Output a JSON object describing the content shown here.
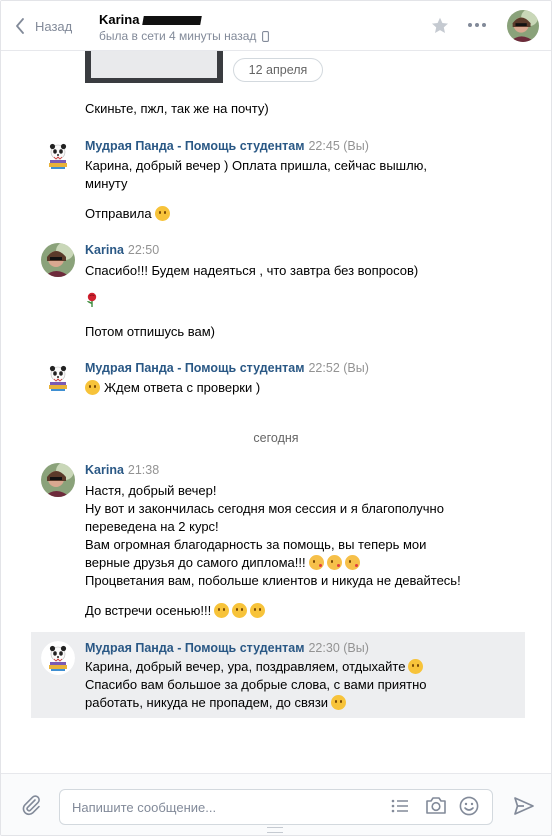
{
  "header": {
    "back_label": "Назад",
    "chat_name": "Karina",
    "status": "была в сети 4 минуты назад"
  },
  "dates": {
    "pill": "12 апреля",
    "separator": "сегодня"
  },
  "compose": {
    "placeholder": "Напишите сообщение..."
  },
  "colors": {
    "author": "#2a5885",
    "highlight": "#edeef0",
    "muted": "#939393"
  },
  "messages": [
    {
      "line": "Скиньте, пжл, так же на почту)"
    },
    {
      "author": "Мудрая Панда - Помощь студентам",
      "time": "22:45 (Вы)",
      "lines": [
        "Карина, добрый вечер ) Оплата пришла, сейчас вышлю,",
        "минуту"
      ],
      "extra": "Отправила"
    },
    {
      "author": "Karina",
      "time": "22:50",
      "lines": [
        "Спасибо!!! Будем надеяться , что завтра без вопросов)",
        "Потом отпишусь вам)"
      ]
    },
    {
      "author": "Мудрая Панда - Помощь студентам",
      "time": "22:52 (Вы)",
      "lines": [
        "Ждем ответа с проверки )"
      ]
    },
    {
      "author": "Karina",
      "time": "21:38",
      "lines": [
        "Настя, добрый вечер!",
        "Ну вот и закончилась сегодня моя сессия и я благополучно",
        "переведена на 2 курс!",
        "Вам огромная благодарность за помощь, вы теперь мои",
        "верные друзья до самого диплома!!!",
        "Процветания вам, побольше клиентов и никуда не девайтесь!",
        "До встречи осенью!!!"
      ]
    },
    {
      "author": "Мудрая Панда - Помощь студентам",
      "time": "22:30 (Вы)",
      "lines": [
        "Карина, добрый вечер, ура, поздравляем, отдыхайте",
        "Спасибо вам большое за добрые слова, с вами приятно",
        "работать, никуда не пропадем, до связи"
      ]
    }
  ]
}
